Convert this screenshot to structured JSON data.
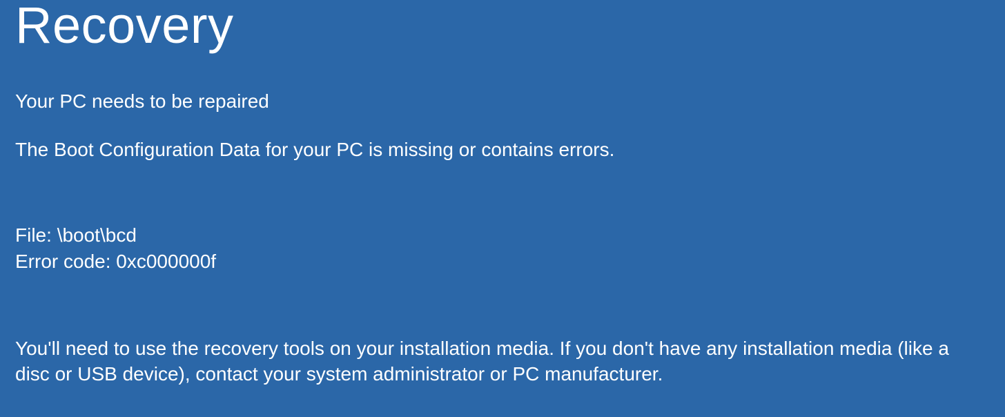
{
  "screen": {
    "title": "Recovery",
    "subtitle": "Your PC needs to be repaired",
    "description": "The Boot Configuration Data for your PC is missing or contains errors.",
    "file_label": "File: ",
    "file_path": "\\boot\\bcd",
    "error_label": "Error code: ",
    "error_code": "0xc000000f",
    "instructions": "You'll need to use the recovery tools on your installation media. If you don't have any installation media (like a disc or USB device), contact your system administrator or PC manufacturer."
  }
}
